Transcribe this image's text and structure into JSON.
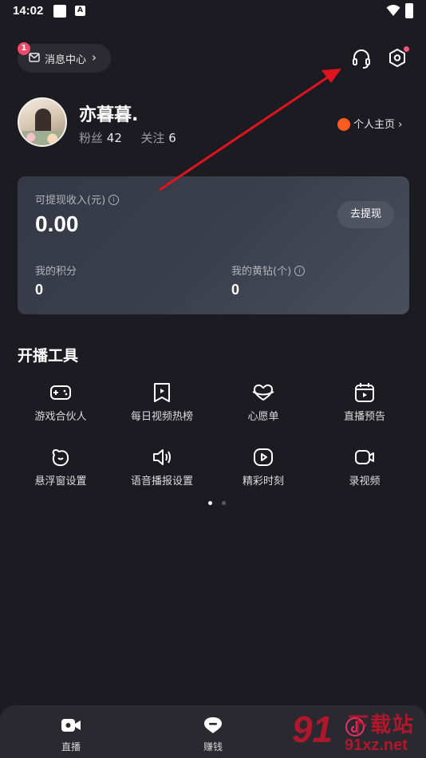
{
  "status_bar": {
    "time": "14:02",
    "a_badge": "A"
  },
  "header": {
    "message_center_label": "消息中心",
    "message_badge_count": "1",
    "chevron": "›"
  },
  "profile": {
    "username": "亦暮暮.",
    "fans_label": "粉丝",
    "fans_count": "42",
    "following_label": "关注",
    "following_count": "6",
    "homepage_label": "个人主页",
    "homepage_chevron": "›"
  },
  "income_card": {
    "withdrawable_label": "可提现收入(元)",
    "withdrawable_value": "0.00",
    "withdraw_button": "去提现",
    "points_label": "我的积分",
    "points_value": "0",
    "diamonds_label": "我的黄钻(个)",
    "diamonds_value": "0",
    "info_glyph": "i"
  },
  "tools": {
    "title": "开播工具",
    "items": [
      {
        "label": "游戏合伙人",
        "icon": "gamepad-icon"
      },
      {
        "label": "每日视频热榜",
        "icon": "video-bookmark-icon"
      },
      {
        "label": "心愿单",
        "icon": "wishlist-icon"
      },
      {
        "label": "直播预告",
        "icon": "calendar-play-icon"
      },
      {
        "label": "悬浮窗设置",
        "icon": "floating-window-icon"
      },
      {
        "label": "语音播报设置",
        "icon": "speaker-icon"
      },
      {
        "label": "精彩时刻",
        "icon": "highlight-play-icon"
      },
      {
        "label": "录视频",
        "icon": "video-camera-icon"
      }
    ],
    "page_count": 2,
    "active_page": 1
  },
  "bottom_nav": {
    "items": [
      {
        "label": "直播",
        "icon": "live-camera-icon"
      },
      {
        "label": "赚钱",
        "icon": "earn-icon"
      },
      {
        "label": "",
        "icon": "music-logo-icon"
      }
    ]
  },
  "watermark": {
    "logo": "91",
    "text": "下载站",
    "url": "91xz.net"
  },
  "colors": {
    "background": "#1c1b21",
    "card_start": "#353945",
    "badge": "#f04a6a",
    "accent_orange": "#ff5a1f",
    "arrow": "#e0141e"
  }
}
